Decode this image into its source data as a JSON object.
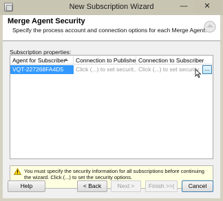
{
  "window": {
    "title": "New Subscription Wizard",
    "minimize_glyph": "—",
    "close_glyph": "✕"
  },
  "header": {
    "title": "Merge Agent Security",
    "description": "Specify the process account and connection options for each Merge Agent."
  },
  "grid": {
    "label": "Subscription properties:",
    "columns": [
      "Agent for Subscriber",
      "Connection to Publisher ...",
      "Connection to Subscriber"
    ],
    "rows": [
      {
        "agent": "VQT-227268FA4D5",
        "publisher_conn": "Click (...) to set securit...",
        "subscriber_conn": "Click (...) to set security...",
        "ellipsis": "..."
      }
    ]
  },
  "warning": {
    "text": "You must specify the security information for all subscriptions before continuing the wizard. Click (...) to set the security options."
  },
  "buttons": {
    "help": "Help",
    "back": "< Back",
    "next": "Next >",
    "finish": "Finish >>|",
    "cancel": "Cancel"
  },
  "colors": {
    "selection": "#3399ff",
    "warning_bg": "#ffffe1",
    "frame": "#d6d2c3"
  }
}
